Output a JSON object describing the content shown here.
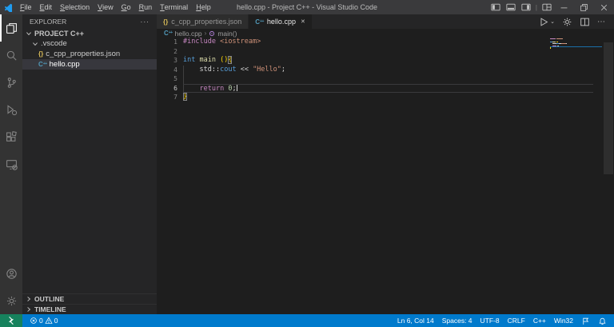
{
  "colors": {
    "titlebar_bg": "#3a3a3c",
    "activitybar_bg": "#333333",
    "sidebar_bg": "#252526",
    "editor_bg": "#1e1e1e",
    "tab_inactive_bg": "#2d2d2d",
    "selection_bg": "#37373d",
    "statusbar_bg": "#007acc",
    "remote_bg": "#16825d",
    "logo_blue": "#1f9cf0",
    "json_icon": "#d7ba57",
    "cpp_icon": "#519aba",
    "method_icon": "#b180d7",
    "minimap_line": "#1b6fa8",
    "token": {
      "preproc": "#c586c0",
      "keyword": "#569cd6",
      "control": "#c586c0",
      "function": "#dcdcaa",
      "string": "#ce9178",
      "number": "#b5cea8",
      "plain": "#d4d4d4",
      "bracket": "#ffd700"
    }
  },
  "titlebar": {
    "title": "hello.cpp - Project C++ - Visual Studio Code",
    "menus": [
      "File",
      "Edit",
      "Selection",
      "View",
      "Go",
      "Run",
      "Terminal",
      "Help"
    ]
  },
  "activity_bar": {
    "top": [
      {
        "icon": "files-icon",
        "active": true
      },
      {
        "icon": "search-icon",
        "active": false
      },
      {
        "icon": "source-control-icon",
        "active": false
      },
      {
        "icon": "run-debug-icon",
        "active": false
      },
      {
        "icon": "extensions-icon",
        "active": false
      },
      {
        "icon": "remote-explorer-icon",
        "active": false
      }
    ],
    "bottom": [
      {
        "icon": "accounts-icon",
        "active": false
      },
      {
        "icon": "settings-gear-icon",
        "active": false
      }
    ]
  },
  "explorer": {
    "header": "EXPLORER",
    "tree": [
      {
        "label": "PROJECT C++",
        "type": "root",
        "indent": 0,
        "selected": false
      },
      {
        "label": ".vscode",
        "type": "folder",
        "indent": 1,
        "selected": false
      },
      {
        "label": "c_cpp_properties.json",
        "type": "json",
        "indent": 2,
        "selected": false
      },
      {
        "label": "hello.cpp",
        "type": "cpp",
        "indent": 2,
        "selected": true
      }
    ],
    "sections": [
      "OUTLINE",
      "TIMELINE"
    ]
  },
  "tabs": [
    {
      "label": "c_cpp_properties.json",
      "icon": "json",
      "active": false
    },
    {
      "label": "hello.cpp",
      "icon": "cpp",
      "active": true
    }
  ],
  "breadcrumb": {
    "file": "hello.cpp",
    "separator": "›",
    "symbol": "main()"
  },
  "code": {
    "lines": [
      {
        "num": "1",
        "tokens": [
          [
            "#include",
            "preproc"
          ],
          [
            " ",
            "plain"
          ],
          [
            "<iostream>",
            "string"
          ]
        ]
      },
      {
        "num": "2",
        "tokens": []
      },
      {
        "num": "3",
        "tokens": [
          [
            "int",
            "keyword"
          ],
          [
            " ",
            "plain"
          ],
          [
            "main",
            "function"
          ],
          [
            " ",
            "plain"
          ],
          [
            "()",
            "bracket"
          ],
          [
            "{",
            "bracket",
            "box"
          ]
        ]
      },
      {
        "num": "4",
        "tokens": [
          [
            "    ",
            "plain"
          ],
          [
            "std",
            "plain"
          ],
          [
            "::",
            "plain"
          ],
          [
            "cout",
            "keyword"
          ],
          [
            " << ",
            "plain"
          ],
          [
            "\"Hello\"",
            "string"
          ],
          [
            ";",
            "plain"
          ]
        ]
      },
      {
        "num": "5",
        "tokens": []
      },
      {
        "num": "6",
        "active": true,
        "cursor": true,
        "tokens": [
          [
            "    ",
            "plain"
          ],
          [
            "return",
            "control"
          ],
          [
            " ",
            "plain"
          ],
          [
            "0",
            "number"
          ],
          [
            ";",
            "plain"
          ]
        ]
      },
      {
        "num": "7",
        "tokens": [
          [
            "}",
            "bracket",
            "box"
          ]
        ]
      }
    ]
  },
  "status_bar": {
    "errors": "0",
    "warnings": "0",
    "right": [
      "Ln 6, Col 14",
      "Spaces: 4",
      "UTF-8",
      "CRLF",
      "C++",
      "Win32"
    ]
  }
}
